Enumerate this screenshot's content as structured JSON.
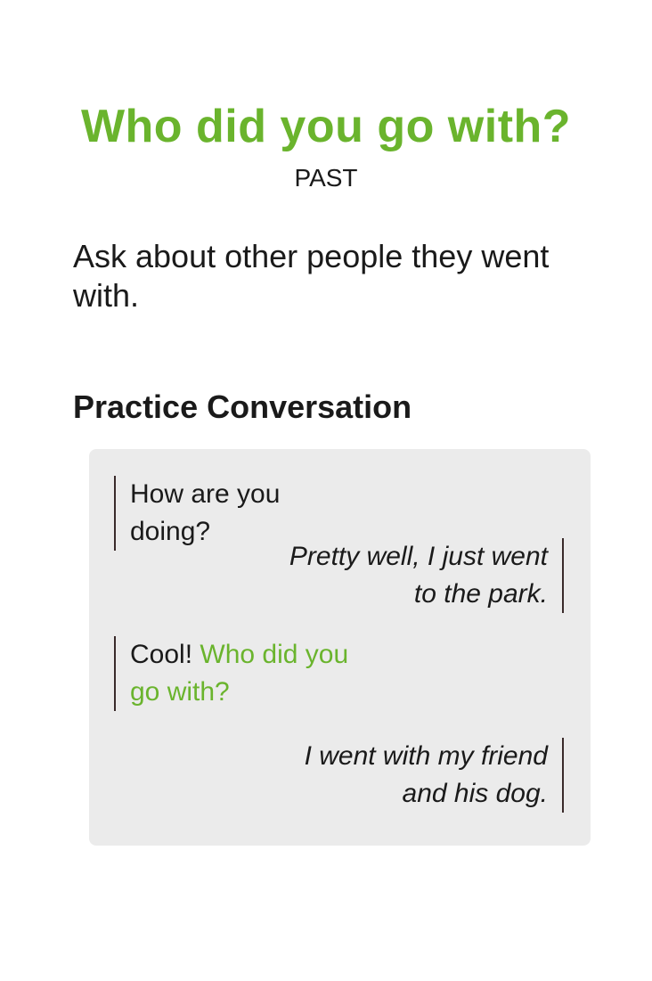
{
  "card": {
    "title": "Who did you go with?",
    "tense": "PAST",
    "instruction": "Ask about other people they went with.",
    "section_heading": "Practice Conversation"
  },
  "conversation": {
    "line1": "How are you doing?",
    "line2": "Pretty well, I just went to the park.",
    "line3_prefix": "Cool! ",
    "line3_highlight": "Who did you go with?",
    "line4": "I went with my friend and his dog."
  },
  "colors": {
    "accent": "#6ab42d",
    "box_background": "#ebebeb",
    "text": "#1a1a1a"
  }
}
